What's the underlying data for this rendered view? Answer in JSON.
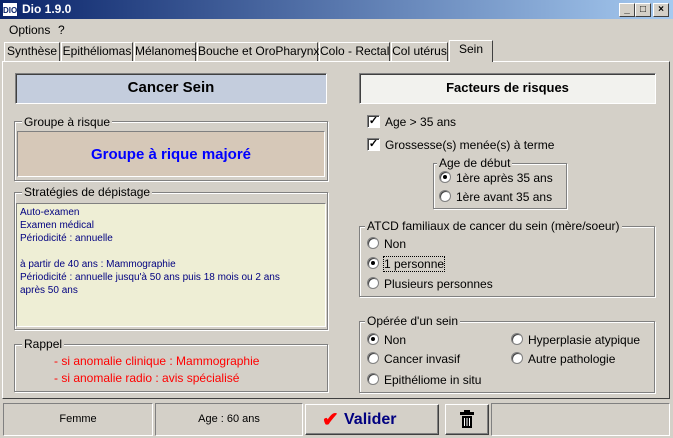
{
  "window": {
    "icon_text": "DIO",
    "title": "Dio 1.9.0",
    "minimize": "_",
    "maximize": "□",
    "close": "×"
  },
  "menu": [
    {
      "label": "Options"
    },
    {
      "label": "?"
    }
  ],
  "tabs": [
    {
      "label": "Synthèse"
    },
    {
      "label": "Epithéliomas"
    },
    {
      "label": "Mélanomes"
    },
    {
      "label": "Bouche et OroPharynx"
    },
    {
      "label": "Colo - Rectal"
    },
    {
      "label": "Col utérus"
    },
    {
      "label": "Sein",
      "active": true
    }
  ],
  "left": {
    "header": "Cancer Sein",
    "groupe": {
      "legend": "Groupe à risque",
      "value": "Groupe à rique majoré",
      "value_color": "#0000ff",
      "bg": "#d6c8b8"
    },
    "strategies": {
      "legend": "Stratégies de dépistage",
      "lines": [
        "Auto-examen",
        "Examen médical",
        "Périodicité : annuelle",
        "",
        "à partir de 40 ans : Mammographie",
        "Périodicité : annuelle jusqu'à 50 ans puis 18 mois ou 2 ans",
        "après 50 ans"
      ]
    },
    "rappel": {
      "legend": "Rappel",
      "lines": [
        "- si anomalie clinique : Mammographie",
        "- si anomalie radio : avis spécialisé"
      ]
    }
  },
  "right": {
    "header": "Facteurs de risques",
    "age_check": {
      "label": "Age > 35 ans",
      "checked": true
    },
    "grossesse_check": {
      "label": "Grossesse(s) menée(s) à terme",
      "checked": true
    },
    "age_debut": {
      "legend": "Age de début",
      "options": [
        {
          "label": "1ère après 35 ans",
          "selected": true
        },
        {
          "label": "1ère avant 35 ans",
          "selected": false
        }
      ]
    },
    "atcd": {
      "legend": "ATCD familiaux de cancer du sein (mère/soeur)",
      "options": [
        {
          "label": "Non",
          "selected": false
        },
        {
          "label": "1 personne",
          "selected": true
        },
        {
          "label": "Plusieurs personnes",
          "selected": false
        }
      ]
    },
    "operee": {
      "legend": "Opérée d'un sein",
      "options": [
        {
          "label": "Non",
          "selected": true
        },
        {
          "label": "Cancer invasif",
          "selected": false
        },
        {
          "label": "Epithéliome in situ",
          "selected": false
        },
        {
          "label": "Hyperplasie atypique",
          "selected": false
        },
        {
          "label": "Autre pathologie",
          "selected": false
        }
      ]
    }
  },
  "status": {
    "sexe": "Femme",
    "age": "Age : 60 ans",
    "valider": "Valider",
    "check_icon": "check-icon",
    "trash_icon": "trash-icon",
    "check_color": "#ff0000",
    "valider_color": "#000080"
  }
}
